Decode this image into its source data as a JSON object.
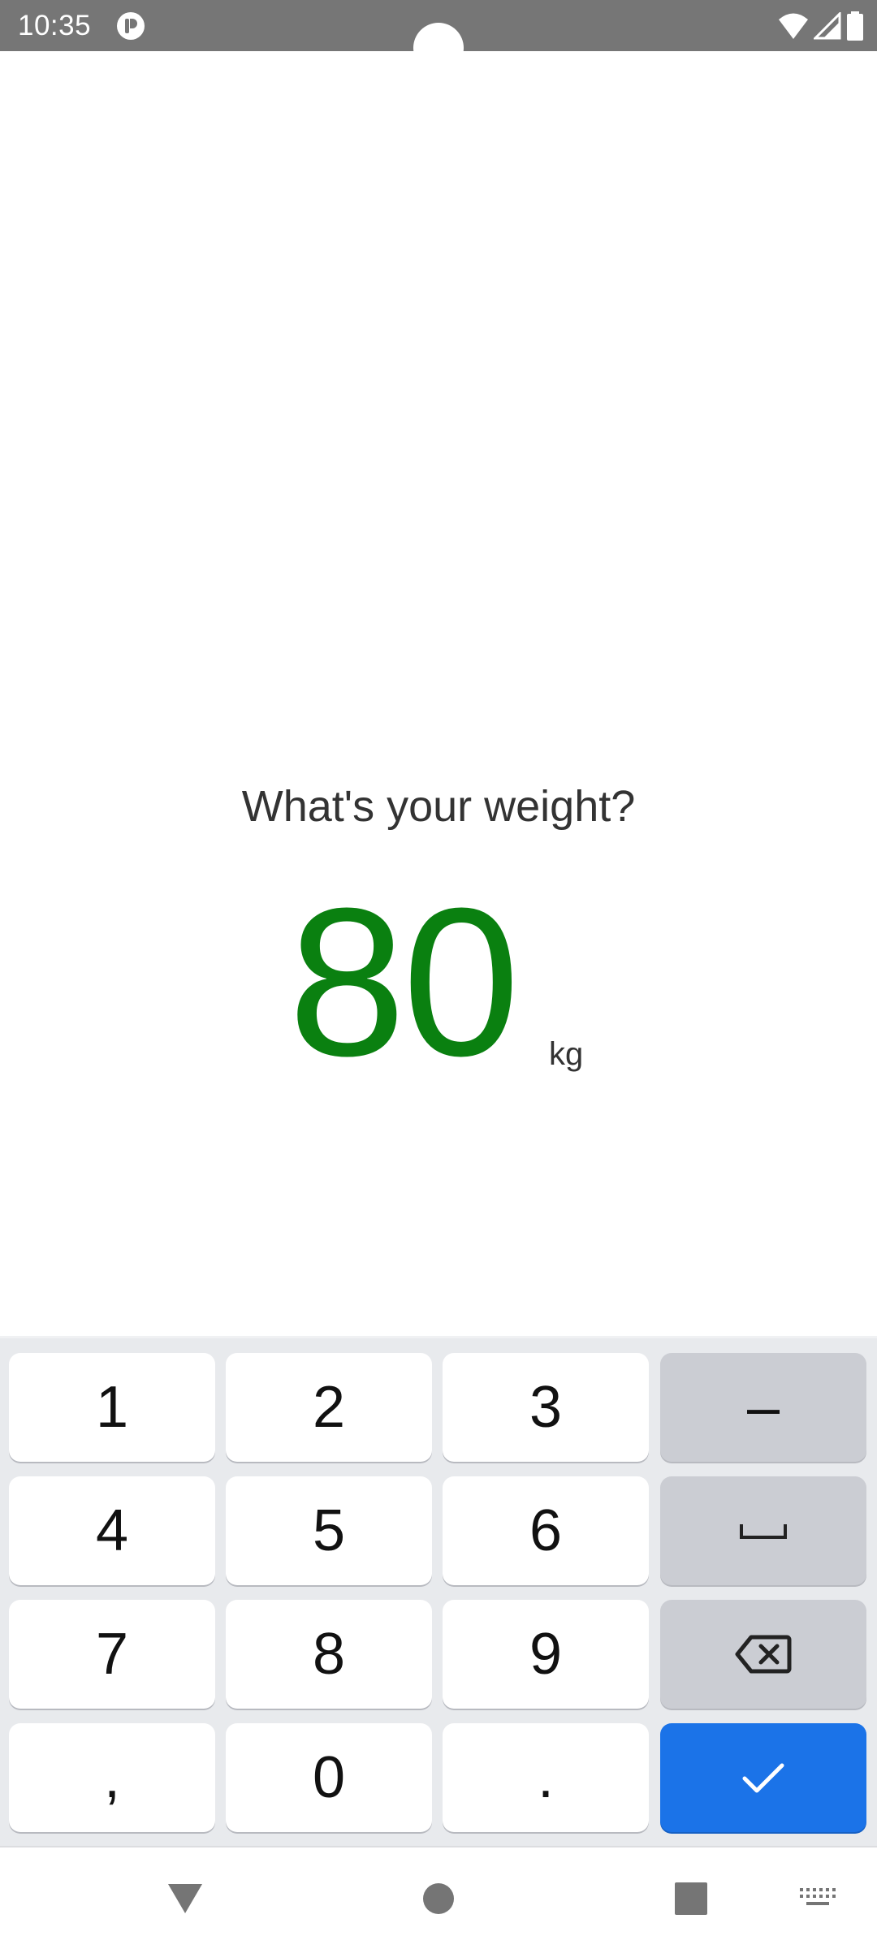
{
  "status_bar": {
    "time": "10:35",
    "icons": [
      "app-notification-icon",
      "wifi-icon",
      "cell-signal-icon",
      "battery-icon"
    ]
  },
  "main": {
    "question": "What's your weight?",
    "value": "80",
    "unit": "kg",
    "value_color": "#0a8010"
  },
  "keyboard": {
    "keys": {
      "k1": "1",
      "k2": "2",
      "k3": "3",
      "minus": "–",
      "k4": "4",
      "k5": "5",
      "k6": "6",
      "k7": "7",
      "k8": "8",
      "k9": "9",
      "comma": ",",
      "k0": "0",
      "period": "."
    },
    "function_icons": [
      "space-icon",
      "backspace-icon",
      "checkmark-icon"
    ],
    "enter_color": "#1b73e8"
  },
  "nav_bar": {
    "icons": [
      "back-icon",
      "home-icon",
      "recents-icon",
      "keyboard-switch-icon"
    ]
  }
}
